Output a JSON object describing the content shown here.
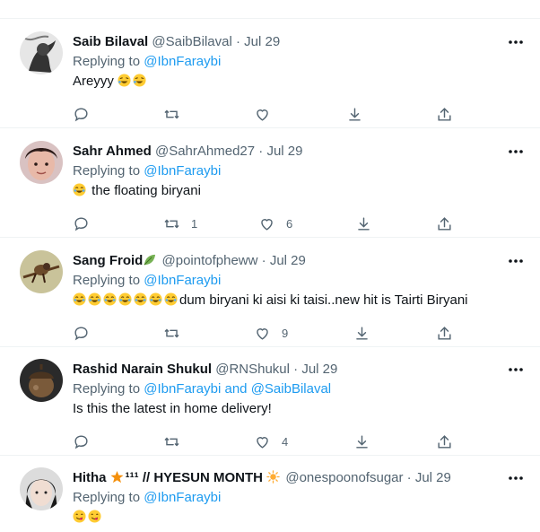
{
  "tweets": [
    {
      "name": "Saib Bilaval",
      "name_suffix": "",
      "handle": "@SaibBilaval",
      "sep": "·",
      "time": "Jul 29",
      "replying_prefix": "Replying to",
      "mentions": [
        "@IbnFaraybi"
      ],
      "mention_joiner": "",
      "text": "Areyyy",
      "emoji_after": [
        "rofl-emoji",
        "rofl-emoji"
      ],
      "emoji_before": [],
      "counts": {
        "reply": "",
        "retweet": "",
        "like": "",
        "share": ""
      }
    },
    {
      "name": "Sahr Ahmed",
      "name_suffix": "",
      "handle": "@SahrAhmed27",
      "sep": "·",
      "time": "Jul 29",
      "replying_prefix": "Replying to",
      "mentions": [
        "@IbnFaraybi"
      ],
      "mention_joiner": "",
      "text": "the floating biryani",
      "emoji_after": [],
      "emoji_before": [
        "joy-emoji"
      ],
      "counts": {
        "reply": "",
        "retweet": "1",
        "like": "6",
        "share": ""
      }
    },
    {
      "name": "Sang Froid",
      "name_suffix": "",
      "handle": "@pointofpheww",
      "sep": "·",
      "time": "Jul 29",
      "replying_prefix": "Replying to",
      "mentions": [
        "@IbnFaraybi"
      ],
      "mention_joiner": "",
      "text": "dum biryani ki aisi ki taisi..new hit is Tairti Biryani",
      "emoji_after": [],
      "emoji_before": [
        "joy-emoji",
        "joy-emoji",
        "joy-emoji",
        "joy-emoji",
        "joy-emoji",
        "joy-emoji",
        "joy-emoji"
      ],
      "counts": {
        "reply": "",
        "retweet": "",
        "like": "9",
        "share": ""
      }
    },
    {
      "name": "Rashid Narain Shukul",
      "name_suffix": "",
      "handle": "@RNShukul",
      "sep": "·",
      "time": "Jul 29",
      "replying_prefix": "Replying to",
      "mentions": [
        "@IbnFaraybi",
        "@SaibBilaval"
      ],
      "mention_joiner": "and",
      "text": "Is this the latest in home delivery!",
      "emoji_after": [],
      "emoji_before": [],
      "counts": {
        "reply": "",
        "retweet": "",
        "like": "4",
        "share": ""
      }
    },
    {
      "name": "Hitha",
      "name_suffix": "¹¹¹ // HYESUN MONTH",
      "handle": "@onespoonofsugar",
      "sep": "·",
      "time": "Jul 29",
      "replying_prefix": "Replying to",
      "mentions": [
        "@IbnFaraybi"
      ],
      "mention_joiner": "",
      "text": "",
      "emoji_after": [],
      "emoji_before": [
        "yum-emoji",
        "yum-emoji"
      ],
      "counts": {
        "reply": "",
        "retweet": "",
        "like": "",
        "share": ""
      }
    }
  ],
  "colors": {
    "accent": "#1d9bf0",
    "muted": "#536471",
    "text": "#0f1419",
    "divider": "#eff3f4"
  }
}
